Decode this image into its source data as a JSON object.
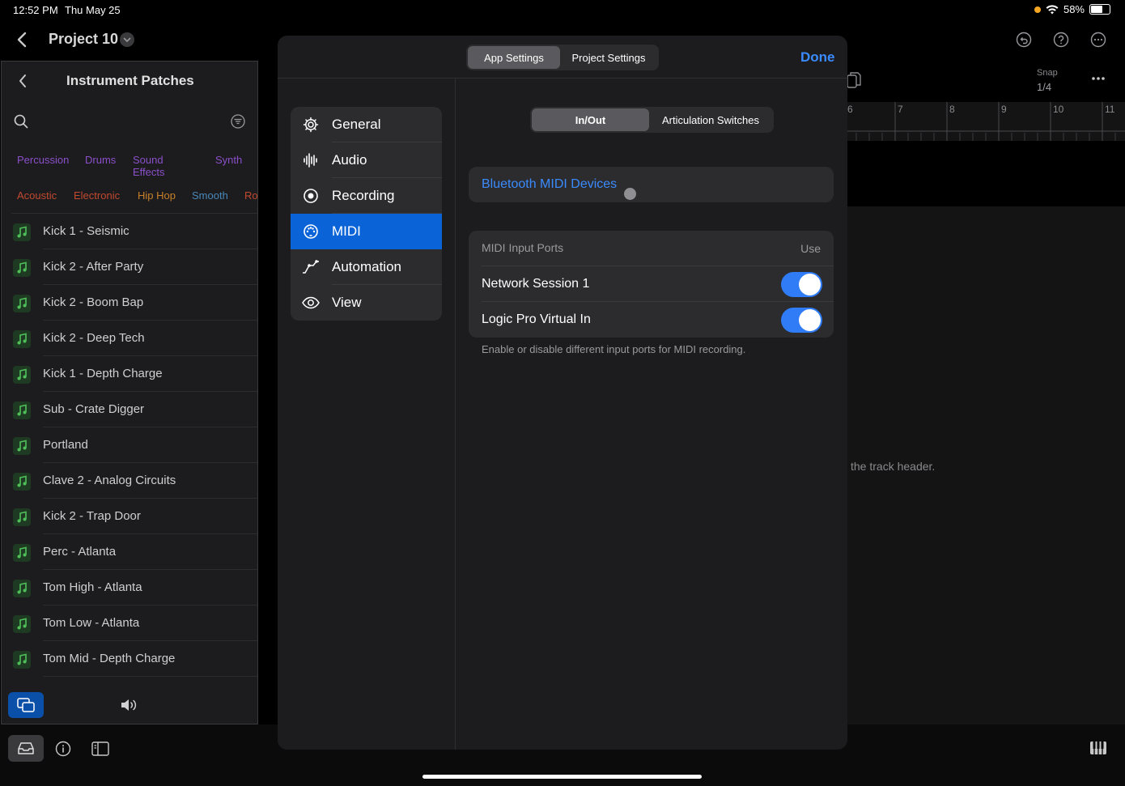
{
  "status_bar": {
    "time": "12:52 PM",
    "date": "Thu May 25",
    "battery": "58%"
  },
  "nav": {
    "project_title": "Project 10"
  },
  "library": {
    "title": "Instrument Patches",
    "tags_row1": [
      {
        "label": "Percussion",
        "color": "#8a4fc9"
      },
      {
        "label": "Drums",
        "color": "#8a4fc9"
      },
      {
        "label": "Sound Effects",
        "color": "#8a4fc9"
      },
      {
        "label": "Synth",
        "color": "#8a4fc9"
      }
    ],
    "tags_row2": [
      {
        "label": "Acoustic",
        "color": "#c0492f"
      },
      {
        "label": "Electronic",
        "color": "#c0492f"
      },
      {
        "label": "Hip Hop",
        "color": "#c8812a"
      },
      {
        "label": "Smooth",
        "color": "#4a87b8"
      },
      {
        "label": "Ro",
        "color": "#c0492f"
      }
    ],
    "patches": [
      "Kick 1 - Seismic",
      "Kick 2 - After Party",
      "Kick 2 - Boom Bap",
      "Kick 2 - Deep Tech",
      "Kick 1 - Depth Charge",
      "Sub - Crate Digger",
      "Portland",
      "Clave 2 - Analog Circuits",
      "Kick 2 - Trap Door",
      "Perc - Atlanta",
      "Tom High - Atlanta",
      "Tom Low - Atlanta",
      "Tom Mid - Depth Charge"
    ]
  },
  "arrange": {
    "snap_label": "Snap",
    "snap_value": "1/4",
    "ruler": [
      "6",
      "7",
      "8",
      "9",
      "10",
      "11"
    ],
    "hint": "the track header."
  },
  "modal": {
    "tabs": [
      "App Settings",
      "Project Settings"
    ],
    "active_tab": "App Settings",
    "done_label": "Done",
    "menu": [
      {
        "label": "General",
        "icon": "gear-icon"
      },
      {
        "label": "Audio",
        "icon": "waveform-icon"
      },
      {
        "label": "Recording",
        "icon": "record-icon"
      },
      {
        "label": "MIDI",
        "icon": "midi-icon"
      },
      {
        "label": "Automation",
        "icon": "automation-icon"
      },
      {
        "label": "View",
        "icon": "eye-icon"
      }
    ],
    "selected_menu": "MIDI",
    "midi_tabs": [
      "In/Out",
      "Articulation Switches"
    ],
    "active_midi_tab": "In/Out",
    "bluetooth_label": "Bluetooth MIDI Devices",
    "ports_header": "MIDI Input Ports",
    "ports_use": "Use",
    "ports": [
      {
        "name": "Network Session 1",
        "enabled": true
      },
      {
        "name": "Logic Pro Virtual In",
        "enabled": true
      }
    ],
    "footnote": "Enable or disable different input ports for MIDI recording."
  },
  "colors": {
    "accent": "#3a8bff",
    "selected": "#0a64d8",
    "toggle_on": "#2f7cf6"
  }
}
